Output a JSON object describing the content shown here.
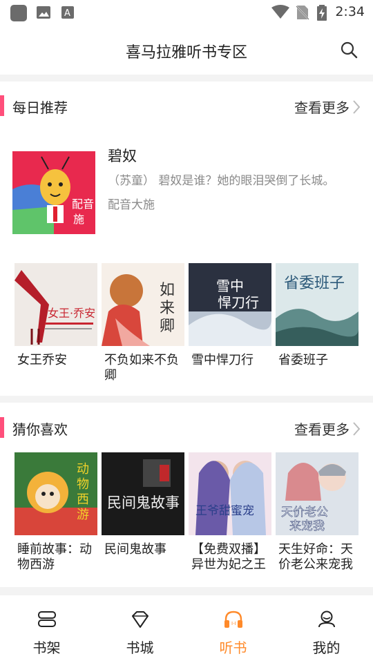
{
  "status_bar": {
    "time": "2:34"
  },
  "header": {
    "title": "喜马拉雅听书专区"
  },
  "sections": {
    "daily": {
      "title": "每日推荐",
      "more_label": "查看更多",
      "featured": {
        "title": "碧奴",
        "desc": "（苏童） 碧奴是谁？她的眼泪哭倒了长城。",
        "author": "配音大施",
        "cover_text": "配大音施"
      },
      "books": [
        {
          "title": "女王乔安",
          "cover_text": "女王·乔安"
        },
        {
          "title": "不负如来不负卿",
          "cover_text": "如来卿"
        },
        {
          "title": "雪中悍刀行",
          "cover_text": "雪中悍刀行"
        },
        {
          "title": "省委班子",
          "cover_text": "省委班子"
        }
      ]
    },
    "guess": {
      "title": "猜你喜欢",
      "more_label": "查看更多",
      "books": [
        {
          "title": "睡前故事：动物西游",
          "cover_text": "动物西游"
        },
        {
          "title": "民间鬼故事",
          "cover_text": "民间鬼故事"
        },
        {
          "title": "【免费双播】异世为妃之王",
          "cover_text": "王爷甜蜜宠"
        },
        {
          "title": "天生好命：天价老公来宠我",
          "cover_text": "天价老公来宠我"
        }
      ]
    }
  },
  "tabs": [
    {
      "label": "书架",
      "icon": "bookshelf-icon"
    },
    {
      "label": "书城",
      "icon": "diamond-icon"
    },
    {
      "label": "听书",
      "icon": "headphones-icon",
      "active": true
    },
    {
      "label": "我的",
      "icon": "person-icon"
    }
  ],
  "colors": {
    "accent": "#ff4f7b",
    "active_tab": "#ff8a2a"
  }
}
